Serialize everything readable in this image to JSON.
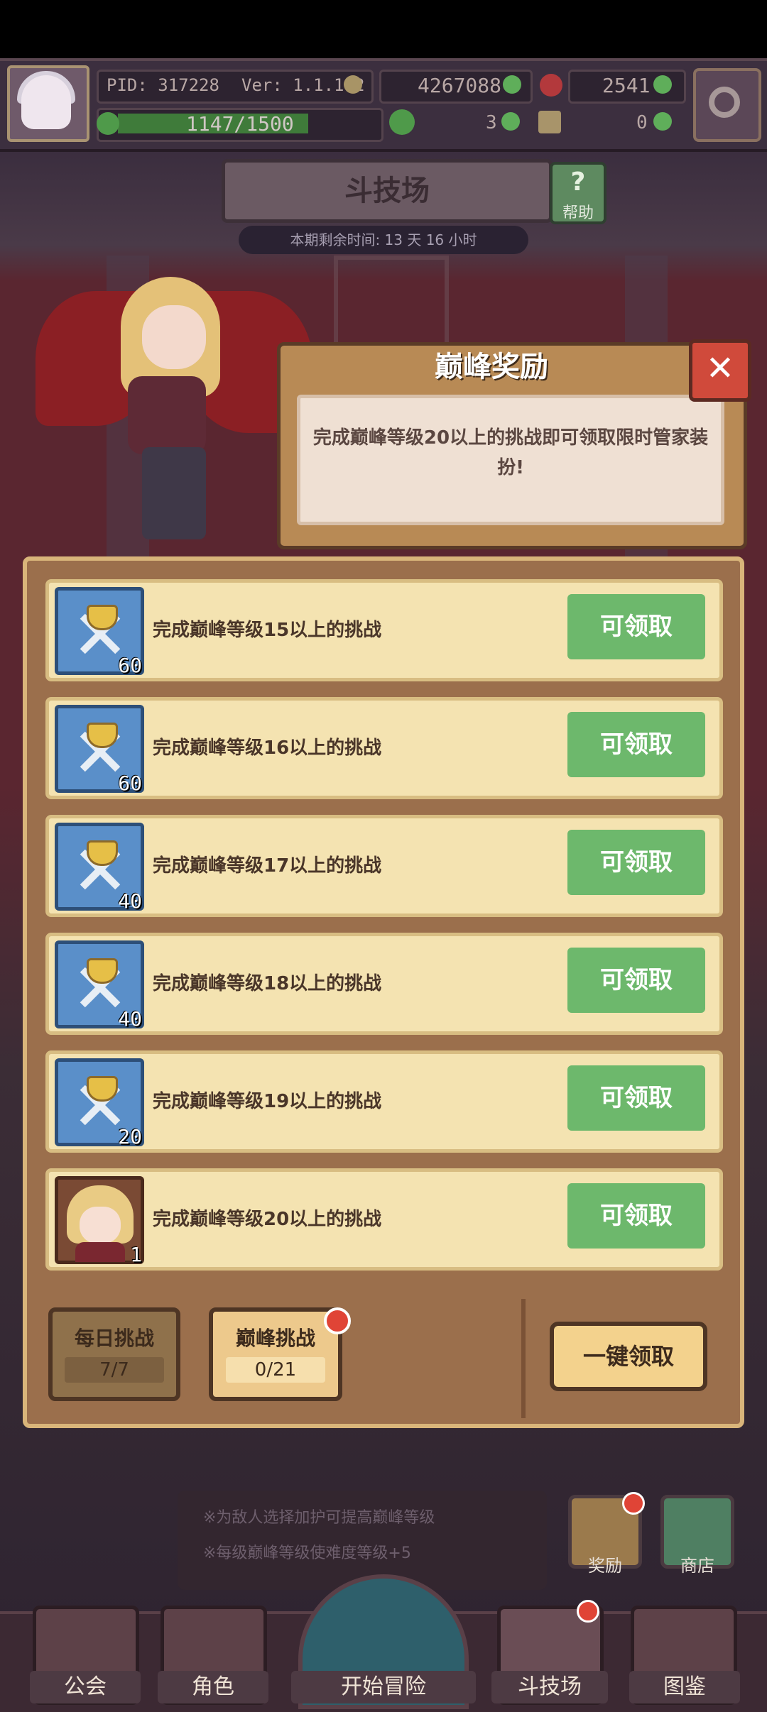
{
  "header": {
    "pid": "PID: 317228",
    "version": "Ver: 1.1.1.2",
    "gold": "4267088",
    "gems": "2541",
    "stamina": "1147/1500",
    "clover": "3",
    "key": "0"
  },
  "arena": {
    "title": "斗技场",
    "help_label": "帮助",
    "help_glyph": "?",
    "timer": "本期剩余时间: 13 天 16 小时"
  },
  "peak_popup": {
    "title": "巅峰奖励",
    "description": "完成巅峰等级20以上的挑战即可领取限时管家装扮!",
    "close_glyph": "✕"
  },
  "rewards": [
    {
      "text": "完成巅峰等级15以上的挑战",
      "qty": "60",
      "button": "可领取",
      "icon": "crossed-swords-icon"
    },
    {
      "text": "完成巅峰等级16以上的挑战",
      "qty": "60",
      "button": "可领取",
      "icon": "crossed-swords-icon"
    },
    {
      "text": "完成巅峰等级17以上的挑战",
      "qty": "40",
      "button": "可领取",
      "icon": "crossed-swords-icon"
    },
    {
      "text": "完成巅峰等级18以上的挑战",
      "qty": "40",
      "button": "可领取",
      "icon": "crossed-swords-icon"
    },
    {
      "text": "完成巅峰等级19以上的挑战",
      "qty": "20",
      "button": "可领取",
      "icon": "crossed-swords-icon"
    },
    {
      "text": "完成巅峰等级20以上的挑战",
      "qty": "1",
      "button": "可领取",
      "icon": "butler-costume-portrait"
    }
  ],
  "tabs": {
    "daily": {
      "label": "每日挑战",
      "count": "7/7"
    },
    "peak": {
      "label": "巅峰挑战",
      "count": "0/21"
    },
    "claim_all": "一键领取"
  },
  "tips": [
    "※为敌人选择加护可提高巅峰等级",
    "※每级巅峰等级使难度等级+5"
  ],
  "side_buttons": {
    "reward": "奖励",
    "shop": "商店"
  },
  "nav": {
    "guild": "公会",
    "character": "角色",
    "adventure": "开始冒险",
    "arena": "斗技场",
    "codex": "图鉴"
  },
  "colors": {
    "claim_green": "#6db86c",
    "panel_brown": "#9b6f4c",
    "row_cream": "#f4e3b1",
    "close_red": "#d04a3b"
  }
}
